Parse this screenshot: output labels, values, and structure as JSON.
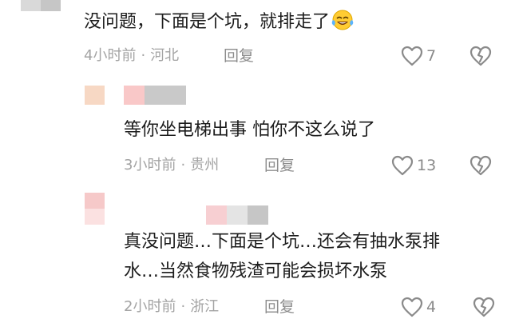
{
  "comments": [
    {
      "text": "没问题，下面是个坑，就排走了",
      "emoji": "laughing-crying-emoji",
      "time": "4小时前",
      "location": "河北",
      "reply_label": "回复",
      "likes": "7"
    },
    {
      "text": "等你坐电梯出事 怕你不这么说了",
      "time": "3小时前",
      "location": "贵州",
      "reply_label": "回复",
      "likes": "13"
    },
    {
      "text_lines": [
        "真没问题…下面是个坑…还会有抽水泵排",
        "水…当然食物残渣可能会损坏水泵"
      ],
      "time": "2小时前",
      "location": "浙江",
      "reply_label": "回复",
      "likes": "4"
    }
  ],
  "separator": "·",
  "icons": {
    "like": "heart-outline-icon",
    "dislike": "broken-heart-icon"
  },
  "colors": {
    "text": "#1c1c1c",
    "meta": "#a3a3a3",
    "icon": "#8a8a8a",
    "background": "#ffffff"
  }
}
